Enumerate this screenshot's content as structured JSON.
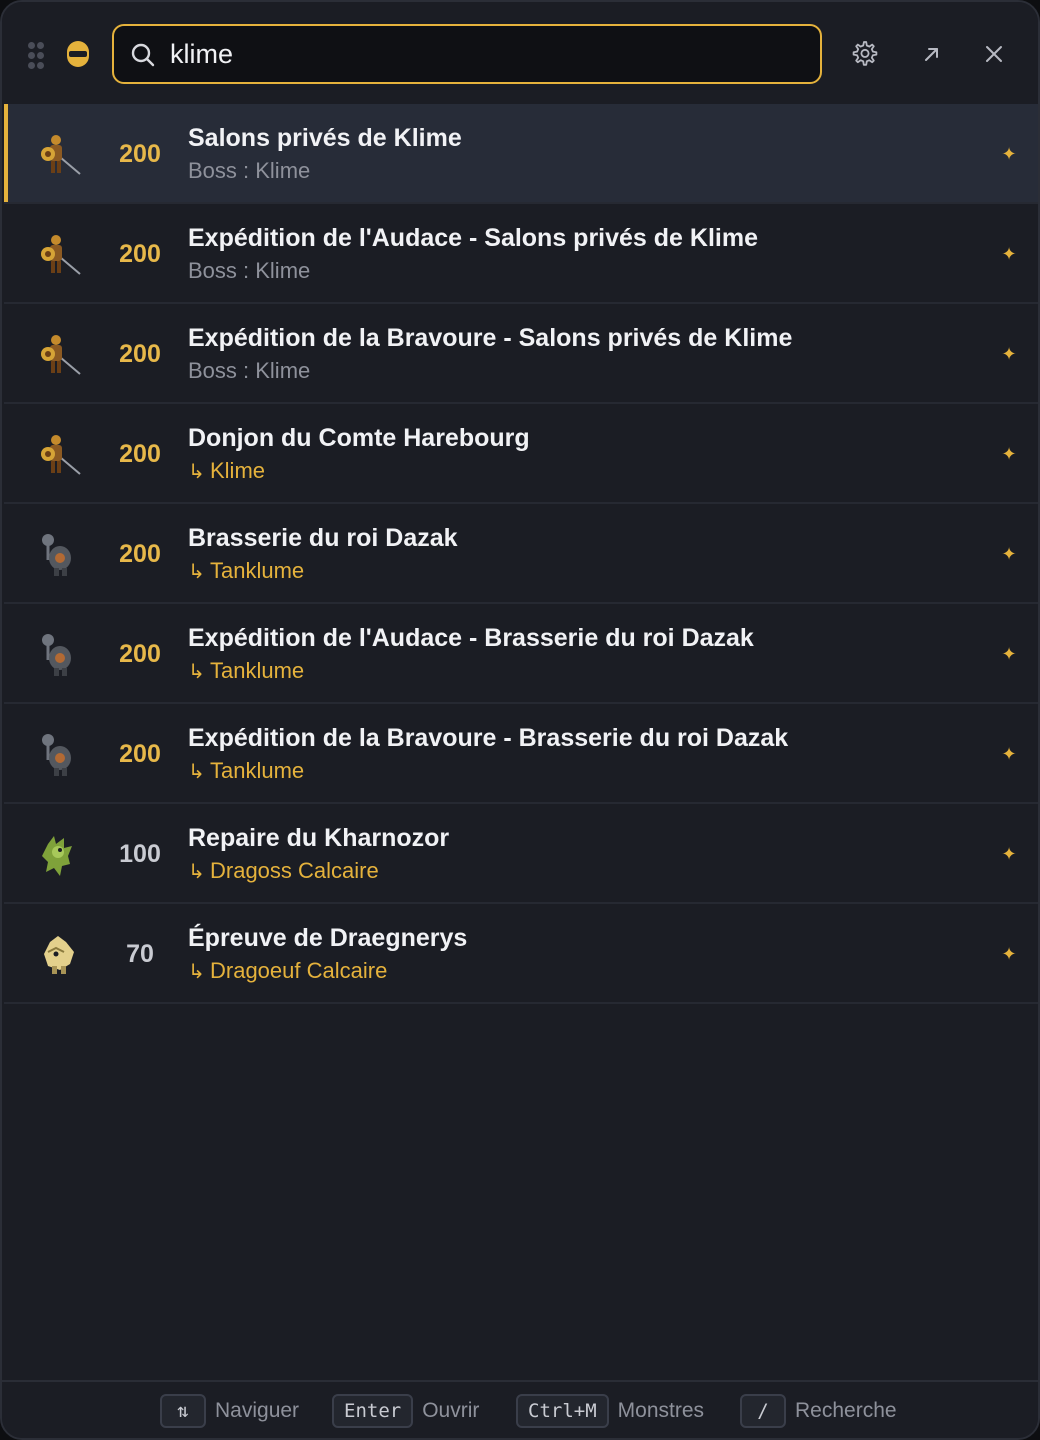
{
  "search": {
    "value": "klime",
    "placeholder": ""
  },
  "header": {
    "settings_icon": "gear-icon",
    "open_icon": "arrow-up-right-icon",
    "close_icon": "close-icon"
  },
  "colors": {
    "accent": "#e5b23c",
    "background": "#1b1d24",
    "selected_row": "#272c38",
    "muted": "#8e919b"
  },
  "results": [
    {
      "level": "200",
      "title": "Salons privés de Klime",
      "subtitle": "Boss : Klime",
      "sub_type": "boss",
      "icon": "klime-warrior-icon"
    },
    {
      "level": "200",
      "title": "Expédition de l'Audace - Salons privés de Klime",
      "subtitle": "Boss : Klime",
      "sub_type": "boss",
      "icon": "klime-warrior-icon"
    },
    {
      "level": "200",
      "title": "Expédition de la Bravoure - Salons privés de Klime",
      "subtitle": "Boss : Klime",
      "sub_type": "boss",
      "icon": "klime-warrior-icon"
    },
    {
      "level": "200",
      "title": "Donjon du Comte Harebourg",
      "subtitle": "Klime",
      "sub_type": "monster",
      "icon": "klime-warrior-icon"
    },
    {
      "level": "200",
      "title": "Brasserie du roi Dazak",
      "subtitle": "Tanklume",
      "sub_type": "monster",
      "icon": "tanklume-armor-icon"
    },
    {
      "level": "200",
      "title": "Expédition de l'Audace - Brasserie du roi Dazak",
      "subtitle": "Tanklume",
      "sub_type": "monster",
      "icon": "tanklume-armor-icon"
    },
    {
      "level": "200",
      "title": "Expédition de la Bravoure - Brasserie du roi Dazak",
      "subtitle": "Tanklume",
      "sub_type": "monster",
      "icon": "tanklume-armor-icon"
    },
    {
      "level": "100",
      "title": "Repaire du Kharnozor",
      "subtitle": "Dragoss Calcaire",
      "sub_type": "monster",
      "icon": "dragoss-green-icon"
    },
    {
      "level": "70",
      "title": "Épreuve de Draegnerys",
      "subtitle": "Dragoeuf Calcaire",
      "sub_type": "monster",
      "icon": "dragoeuf-egg-icon"
    }
  ],
  "footer": {
    "hints": [
      {
        "key": "⇅",
        "label": "Naviguer"
      },
      {
        "key": "Enter",
        "label": "Ouvrir"
      },
      {
        "key": "Ctrl+M",
        "label": "Monstres"
      },
      {
        "key": "/",
        "label": "Recherche"
      }
    ]
  }
}
